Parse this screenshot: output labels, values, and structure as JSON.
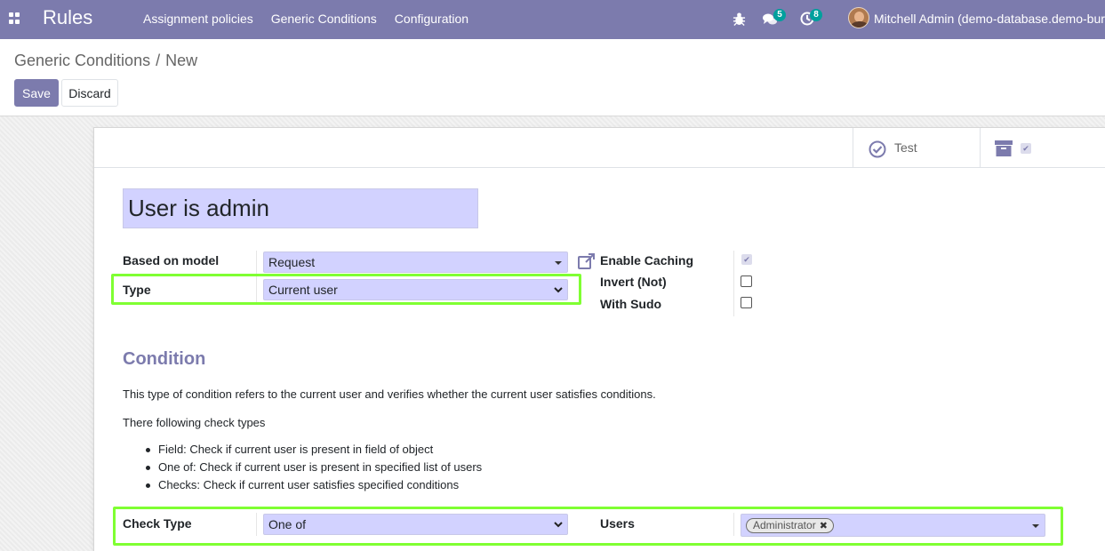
{
  "navbar": {
    "app_title": "Rules",
    "menu": [
      "Assignment policies",
      "Generic Conditions",
      "Configuration"
    ],
    "messages_count": "5",
    "activities_count": "8",
    "user_name": "Mitchell Admin (demo-database.demo-bureaucrat.com)"
  },
  "breadcrumb": {
    "parent": "Generic Conditions",
    "separator": "/",
    "current": "New"
  },
  "toolbar": {
    "save_label": "Save",
    "discard_label": "Discard"
  },
  "button_box": {
    "test_label": "Test"
  },
  "form": {
    "name": "User is admin",
    "based_on_model_label": "Based on model",
    "based_on_model_value": "Request",
    "type_label": "Type",
    "type_value": "Current user",
    "enable_caching_label": "Enable Caching",
    "enable_caching_checked": true,
    "invert_label": "Invert (Not)",
    "invert_checked": false,
    "with_sudo_label": "With Sudo",
    "with_sudo_checked": false
  },
  "condition": {
    "title": "Condition",
    "description": "This type of condition refers to the current user and verifies whether the current user satisfies conditions.",
    "intro": "There following check types",
    "check_types": [
      "Field: Check if current user is present in field of object",
      "One of: Check if current user is present in specified list of users",
      "Checks: Check if current user satisfies specified conditions"
    ],
    "check_type_label": "Check Type",
    "check_type_value": "One of",
    "users_label": "Users",
    "users_tags": [
      "Administrator"
    ]
  },
  "colors": {
    "brand": "#7c7bad",
    "field_bg": "#d2d2ff",
    "badge": "#00a09d",
    "highlight": "#7fff32"
  },
  "icons": [
    "apps-grid-icon",
    "bug-icon",
    "chat-icon",
    "clock-icon",
    "check-circle-icon",
    "archive-icon",
    "external-link-icon",
    "caret-down-icon",
    "chevron-down-icon",
    "remove-tag-icon"
  ]
}
